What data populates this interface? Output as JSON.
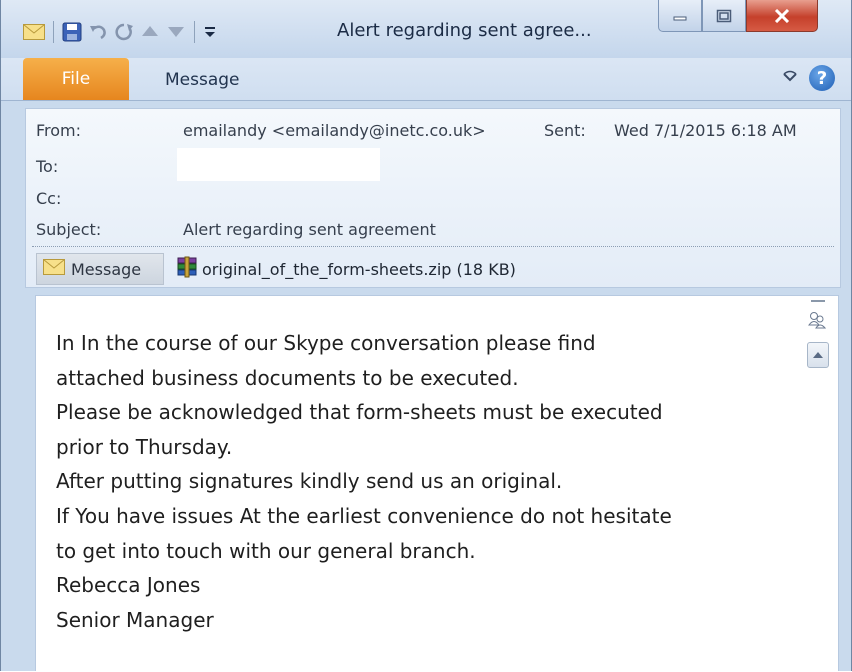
{
  "window": {
    "title": "Alert regarding sent agree..."
  },
  "qat": {
    "icons": [
      "mail-icon",
      "save-icon",
      "undo-icon",
      "redo-icon",
      "previous-item-icon",
      "next-item-icon",
      "customize-toolbar-icon"
    ]
  },
  "ribbon": {
    "file_tab": "File",
    "message_tab": "Message"
  },
  "header": {
    "from_label": "From:",
    "from_value": "emailandy <emailandy@inetc.co.uk>",
    "sent_label": "Sent:",
    "sent_value": "Wed 7/1/2015 6:18 AM",
    "to_label": "To:",
    "to_value": "",
    "cc_label": "Cc:",
    "subject_label": "Subject:",
    "subject_value": "Alert regarding sent agreement",
    "message_button": "Message",
    "attachment": "original_of_the_form-sheets.zip (18 KB)"
  },
  "body": {
    "lines": [
      "In In the course of our Skype conversation please find",
      "attached business documents to be executed.",
      "Please be acknowledged that form-sheets must be executed",
      "prior to Thursday.",
      "After putting signatures kindly send us an original.",
      "If You have issues At the earliest convenience do not hesitate",
      "to get into touch with our general branch.",
      "Rebecca Jones",
      "Senior Manager"
    ]
  },
  "colors": {
    "file_tab": "#e6861e",
    "close_button": "#c5402b",
    "help_icon": "#1f5fb5"
  }
}
